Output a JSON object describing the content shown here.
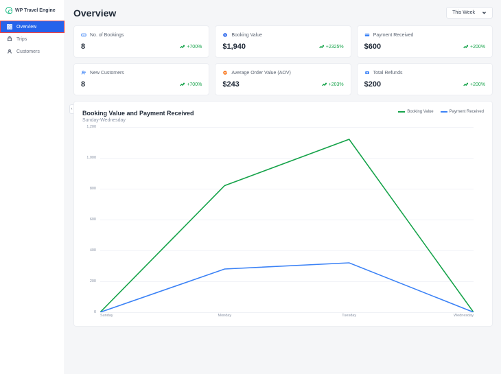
{
  "brand": "WP Travel Engine",
  "nav": [
    {
      "label": "Overview",
      "icon": "grid",
      "active": true
    },
    {
      "label": "Trips",
      "icon": "bag",
      "active": false
    },
    {
      "label": "Customers",
      "icon": "user",
      "active": false
    }
  ],
  "header": {
    "title": "Overview",
    "range_label": "This Week"
  },
  "cards": [
    {
      "icon": "ticket",
      "icon_color": "#3b82f6",
      "label": "No. of Bookings",
      "value": "8",
      "change": "+700%"
    },
    {
      "icon": "dollar",
      "icon_color": "#2563eb",
      "label": "Booking Value",
      "value": "$1,940",
      "change": "+2325%"
    },
    {
      "icon": "card",
      "icon_color": "#3b82f6",
      "label": "Payment Received",
      "value": "$600",
      "change": "+200%"
    },
    {
      "icon": "newuser",
      "icon_color": "#3b82f6",
      "label": "New Customers",
      "value": "8",
      "change": "+700%"
    },
    {
      "icon": "avg",
      "icon_color": "#f97316",
      "label": "Average Order Value (AOV)",
      "value": "$243",
      "change": "+203%"
    },
    {
      "icon": "refund",
      "icon_color": "#3b82f6",
      "label": "Total Refunds",
      "value": "$200",
      "change": "+200%"
    }
  ],
  "chart": {
    "title": "Booking Value and Payment Received",
    "subtitle": "Sunday-Wednesday",
    "legend": [
      {
        "name": "Booking Value",
        "color": "#16a34a"
      },
      {
        "name": "Payment Received",
        "color": "#3b82f6"
      }
    ]
  },
  "chart_data": {
    "type": "line",
    "categories": [
      "Sunday",
      "Monday",
      "Tuesday",
      "Wednesday"
    ],
    "series": [
      {
        "name": "Booking Value",
        "color": "#16a34a",
        "values": [
          0,
          820,
          1120,
          0
        ]
      },
      {
        "name": "Payment Received",
        "color": "#3b82f6",
        "values": [
          0,
          280,
          320,
          0
        ]
      }
    ],
    "ylabel": "",
    "xlabel": "",
    "ylim": [
      0,
      1200
    ],
    "y_ticks": [
      0,
      200,
      400,
      600,
      800,
      1000,
      1200
    ]
  }
}
